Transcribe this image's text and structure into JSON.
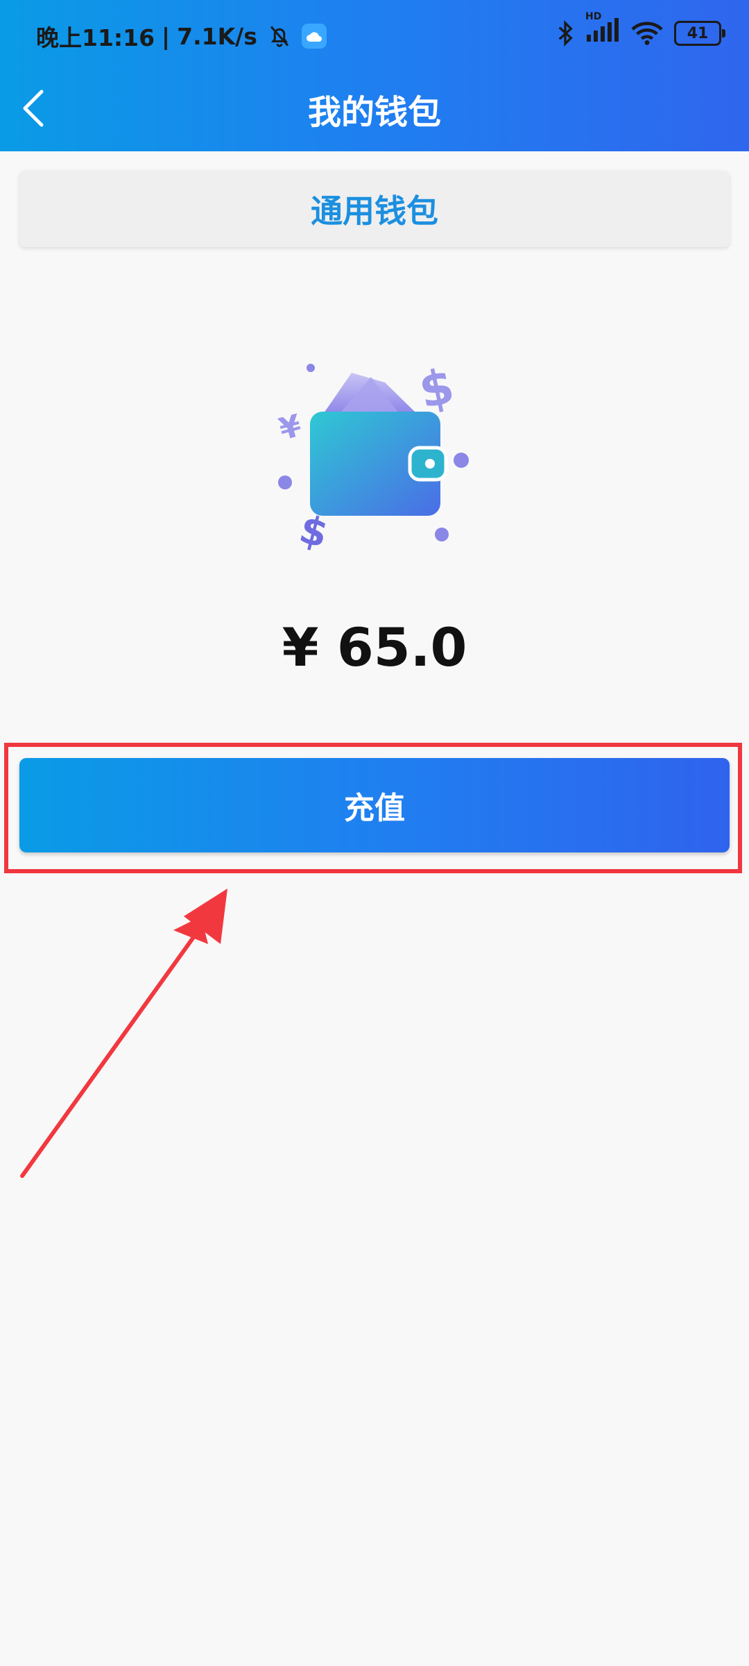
{
  "status_bar": {
    "time": "晚上11:16",
    "network_speed": "7.1K/s",
    "separator": "|",
    "battery_level": "41",
    "signal_label": "HD",
    "icons": [
      "bell-mute-icon",
      "cloud-app-icon",
      "bluetooth-icon",
      "signal-icon",
      "wifi-icon",
      "battery-icon"
    ]
  },
  "header": {
    "title": "我的钱包",
    "back_icon": "chevron-left-icon"
  },
  "wallet_tab": {
    "label": "通用钱包"
  },
  "wallet": {
    "currency_symbol": "¥",
    "balance": "65.0",
    "illustration_icon": "wallet-icon"
  },
  "actions": {
    "recharge_label": "充值"
  },
  "colors": {
    "header_gradient_start": "#0a9be6",
    "header_gradient_end": "#2f66ee",
    "tab_text": "#1c8fe0",
    "highlight": "#f0373f",
    "background": "#f8f8f8"
  }
}
